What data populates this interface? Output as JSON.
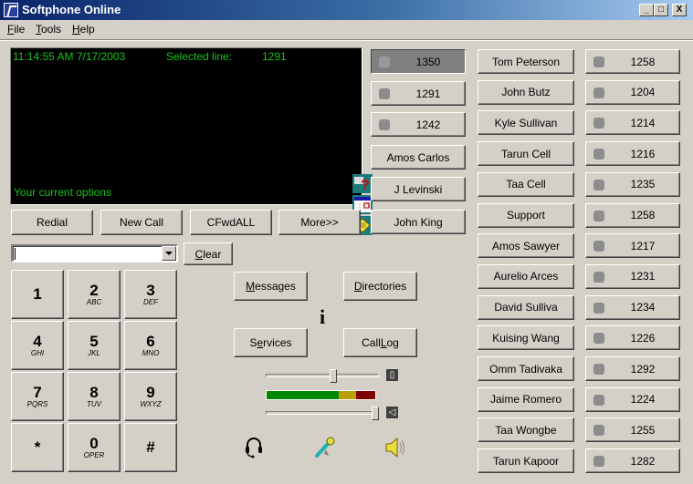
{
  "window": {
    "title": "Softphone Online",
    "controls": {
      "minimize": "_",
      "maximize": "□",
      "close": "X"
    }
  },
  "menu": [
    {
      "label": "File",
      "accel": "F",
      "rest": "ile"
    },
    {
      "label": "Tools",
      "accel": "T",
      "rest": "ools"
    },
    {
      "label": "Help",
      "accel": "H",
      "rest": "elp"
    }
  ],
  "display": {
    "datetime": "11:14:55 AM 7/17/2003",
    "selected_line_label": "Selected line:",
    "selected_line_value": "1291",
    "current_options": "Your current options",
    "side_icons": [
      "help-icon",
      "calendar-icon",
      "notes-icon"
    ]
  },
  "softkeys": [
    "Redial",
    "New Call",
    "CFwdALL",
    "More>>"
  ],
  "dial_input": {
    "value": "",
    "clear_label": "Clear",
    "clear_accel": "C",
    "clear_rest": "lear"
  },
  "lines": [
    {
      "number": "1350",
      "selected": true
    },
    {
      "number": "1291",
      "selected": false
    },
    {
      "number": "1242",
      "selected": false
    }
  ],
  "quick_dials": [
    "Amos Carlos",
    "J Levinski",
    "John King"
  ],
  "keypad": [
    {
      "digit": "1",
      "letters": ""
    },
    {
      "digit": "2",
      "letters": "ABC"
    },
    {
      "digit": "3",
      "letters": "DEF"
    },
    {
      "digit": "4",
      "letters": "GHI"
    },
    {
      "digit": "5",
      "letters": "JKL"
    },
    {
      "digit": "6",
      "letters": "MNO"
    },
    {
      "digit": "7",
      "letters": "PQRS"
    },
    {
      "digit": "8",
      "letters": "TUV"
    },
    {
      "digit": "9",
      "letters": "WXYZ"
    },
    {
      "digit": "*",
      "letters": ""
    },
    {
      "digit": "0",
      "letters": "OPER"
    },
    {
      "digit": "#",
      "letters": ""
    }
  ],
  "functions": {
    "messages": {
      "pre": "",
      "accel": "M",
      "post": "essages"
    },
    "directories": {
      "pre": "",
      "accel": "D",
      "post": "irectories"
    },
    "services": {
      "pre": "S",
      "accel": "e",
      "post": "rvices"
    },
    "call_log": {
      "pre": "Call ",
      "accel": "L",
      "post": "og"
    },
    "info": "i"
  },
  "audio": {
    "mic_level_percent": 60,
    "speaker_volume_percent": 100,
    "meter": {
      "green_percent": 66,
      "yellow_percent": 16,
      "red_percent": 18
    },
    "colors": {
      "green": "#008800",
      "yellow": "#b8a000",
      "red": "#800000"
    }
  },
  "bottom_icons": [
    "headset-icon",
    "microphone-icon",
    "speaker-icon"
  ],
  "speed_dial": [
    {
      "name": "Tom Peterson",
      "ext": "1258"
    },
    {
      "name": "John Butz",
      "ext": "1204"
    },
    {
      "name": "Kyle Sullivan",
      "ext": "1214"
    },
    {
      "name": "Tarun Cell",
      "ext": "1216"
    },
    {
      "name": "Taa Cell",
      "ext": "1235"
    },
    {
      "name": "Support",
      "ext": "1258"
    },
    {
      "name": "Amos Sawyer",
      "ext": "1217"
    },
    {
      "name": "Aurelio Arces",
      "ext": "1231"
    },
    {
      "name": "David Sulliva",
      "ext": "1234"
    },
    {
      "name": "Kuising Wang",
      "ext": "1226"
    },
    {
      "name": "Omm Tadivaka",
      "ext": "1292"
    },
    {
      "name": "Jaime Romero",
      "ext": "1224"
    },
    {
      "name": "Taa Wongbe",
      "ext": "1255"
    },
    {
      "name": "Tarun Kapoor",
      "ext": "1282"
    }
  ]
}
